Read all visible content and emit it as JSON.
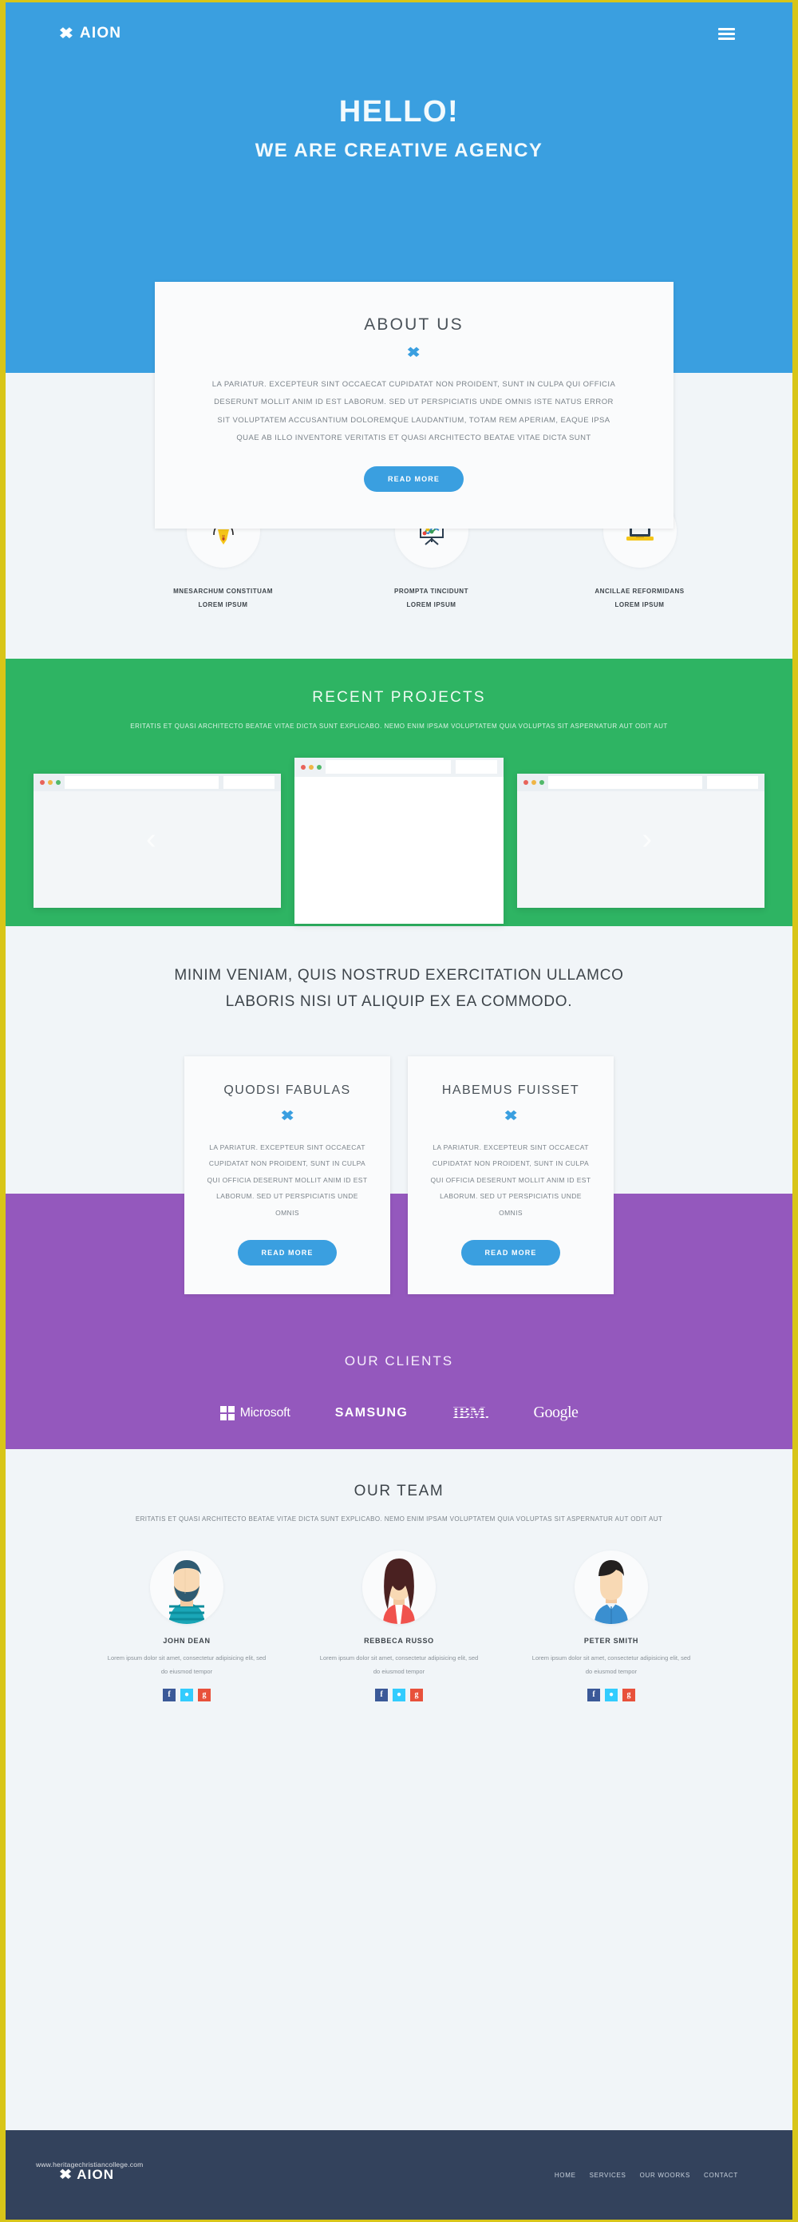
{
  "theme": {
    "blue": "#3a9fe0",
    "green": "#2eb463",
    "purple": "#9458bd",
    "yellow_border": "#d8c518",
    "footer_navy": "#33425c",
    "page_bg": "#f1f5f8"
  },
  "header": {
    "logo_mark": "x-mark",
    "logo_text": "AION",
    "menu_icon": "hamburger-menu"
  },
  "hero": {
    "title": "HELLO!",
    "subtitle": "WE ARE CREATIVE AGENCY"
  },
  "about": {
    "title": "ABOUT US",
    "divider": "✖",
    "body": "LA PARIATUR. EXCEPTEUR SINT OCCAECAT CUPIDATAT NON PROIDENT, SUNT IN CULPA QUI OFFICIA DESERUNT MOLLIT ANIM ID EST LABORUM. SED UT PERSPICIATIS UNDE OMNIS ISTE NATUS ERROR SIT VOLUPTATEM ACCUSANTIUM DOLOREMQUE LAUDANTIUM, TOTAM REM APERIAM, EAQUE IPSA QUAE AB ILLO INVENTORE VERITATIS ET QUASI ARCHITECTO BEATAE VITAE DICTA SUNT",
    "button": "READ MORE"
  },
  "services": [
    {
      "icon": "pen-tool-icon",
      "line1": "MNESARCHUM CONSTITUAM",
      "line2": "LOREM IPSUM"
    },
    {
      "icon": "presentation-chart-icon",
      "line1": "PROMPTA TINCIDUNT",
      "line2": "LOREM IPSUM"
    },
    {
      "icon": "laptop-icon",
      "line1": "ANCILLAE REFORMIDANS",
      "line2": "LOREM IPSUM"
    }
  ],
  "projects": {
    "title": "RECENT PROJECTS",
    "subtitle": "ERITATIS ET QUASI ARCHITECTO BEATAE VITAE DICTA SUNT EXPLICABO. NEMO ENIM IPSAM VOLUPTATEM QUIA VOLUPTAS SIT ASPERNATUR AUT ODIT AUT",
    "prev_icon": "chevron-left-icon",
    "next_icon": "chevron-right-icon"
  },
  "features": {
    "heading_line1": "MINIM VENIAM, QUIS NOSTRUD EXERCITATION ULLAMCO",
    "heading_line2": "LABORIS NISI UT ALIQUIP EX EA COMMODO.",
    "cards": [
      {
        "title": "QUODSI FABULAS",
        "divider": "✖",
        "body": "LA PARIATUR. EXCEPTEUR SINT OCCAECAT CUPIDATAT NON PROIDENT, SUNT IN CULPA QUI OFFICIA DESERUNT MOLLIT ANIM ID EST LABORUM. SED UT PERSPICIATIS UNDE OMNIS",
        "button": "READ MORE"
      },
      {
        "title": "HABEMUS FUISSET",
        "divider": "✖",
        "body": "LA PARIATUR. EXCEPTEUR SINT OCCAECAT CUPIDATAT NON PROIDENT, SUNT IN CULPA QUI OFFICIA DESERUNT MOLLIT ANIM ID EST LABORUM. SED UT PERSPICIATIS UNDE OMNIS",
        "button": "READ MORE"
      }
    ]
  },
  "clients": {
    "title": "OUR CLIENTS",
    "logos": [
      {
        "name": "microsoft-logo",
        "label": "Microsoft"
      },
      {
        "name": "samsung-logo",
        "label": "SAMSUNG"
      },
      {
        "name": "ibm-logo",
        "label": "IBM."
      },
      {
        "name": "google-logo",
        "label": "Google"
      }
    ]
  },
  "team": {
    "title": "OUR TEAM",
    "subtitle": "ERITATIS ET QUASI ARCHITECTO BEATAE VITAE DICTA SUNT EXPLICABO. NEMO ENIM IPSAM VOLUPTATEM QUIA VOLUPTAS SIT ASPERNATUR AUT ODIT AUT",
    "members": [
      {
        "name": "JOHN DEAN",
        "desc": "Lorem ipsum dolor sit amet, consectetur adipisicing elit, sed do eiusmod tempor",
        "avatar": "bearded-man-avatar",
        "socials": [
          "facebook-icon",
          "twitter-icon",
          "google-plus-icon"
        ]
      },
      {
        "name": "REBBECA RUSSO",
        "desc": "Lorem ipsum dolor sit amet, consectetur adipisicing elit, sed do eiusmod tempor",
        "avatar": "long-hair-woman-avatar",
        "socials": [
          "facebook-icon",
          "twitter-icon",
          "google-plus-icon"
        ]
      },
      {
        "name": "PETER SMITH",
        "desc": "Lorem ipsum dolor sit amet, consectetur adipisicing elit, sed do eiusmod tempor",
        "avatar": "short-hair-man-avatar",
        "socials": [
          "facebook-icon",
          "twitter-icon",
          "google-plus-icon"
        ]
      }
    ],
    "social_glyphs": {
      "facebook": "f",
      "twitter": "t",
      "google_plus": "g+"
    }
  },
  "footer": {
    "logo_mark": "x-mark",
    "logo_text": "AION",
    "nav": [
      "HOME",
      "SERVICES",
      "OUR WOORKS",
      "CONTACT"
    ],
    "watermark": "www.heritagechristiancollege.com"
  }
}
